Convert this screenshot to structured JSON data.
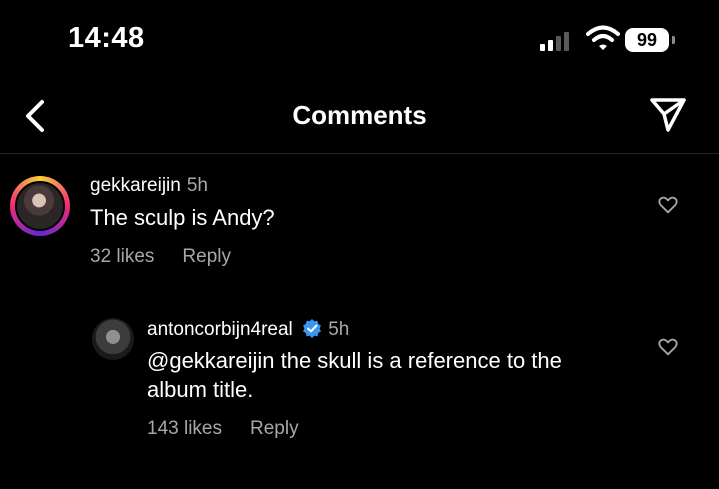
{
  "status_bar": {
    "time": "14:48",
    "battery": "99"
  },
  "header": {
    "title": "Comments"
  },
  "comments": [
    {
      "username": "gekkareijin",
      "time": "5h",
      "text": "The sculp is Andy?",
      "likes": "32 likes",
      "reply": "Reply"
    },
    {
      "username": "antoncorbijn4real",
      "time": "5h",
      "text_line1": "@gekkareijin the skull is a reference to the",
      "text_line2": "album title.",
      "likes": "143 likes",
      "reply": "Reply",
      "verified": true
    }
  ],
  "colors": {
    "background": "#000000",
    "secondary_text": "#a8a8a8",
    "verified_blue": "#3897f0"
  }
}
